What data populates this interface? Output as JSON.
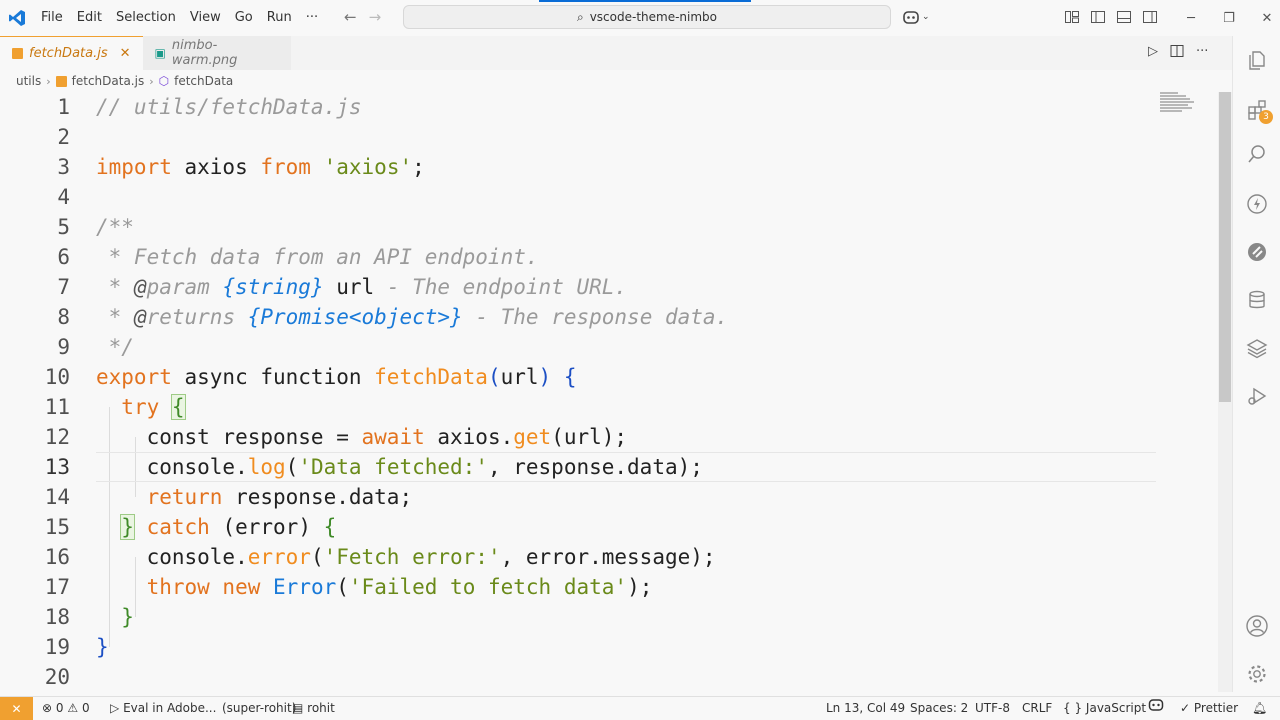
{
  "menu": [
    "File",
    "Edit",
    "Selection",
    "View",
    "Go",
    "Run",
    "···"
  ],
  "search": {
    "text": "vscode-theme-nimbo"
  },
  "tabs": [
    {
      "label": "fetchData.js",
      "icon": "js-file-icon"
    },
    {
      "label": "nimbo-warm.png",
      "icon": "image-file-icon"
    }
  ],
  "breadcrumb": {
    "folder": "utils",
    "file": "fetchData.js",
    "symbol": "fetchData"
  },
  "line_numbers": [
    "1",
    "2",
    "3",
    "4",
    "5",
    "6",
    "7",
    "8",
    "9",
    "10",
    "11",
    "12",
    "13",
    "14",
    "15",
    "16",
    "17",
    "18",
    "19",
    "20"
  ],
  "current_line": 13,
  "activity": {
    "badge": "3"
  },
  "status": {
    "errors": "0",
    "warnings": "0",
    "eval": "Eval in Adobe...",
    "branch": "(super-rohit)",
    "user": "rohit",
    "position": "Ln 13, Col 49",
    "spaces": "Spaces: 2",
    "encoding": "UTF-8",
    "eol": "CRLF",
    "language": "JavaScript",
    "formatter": "Prettier"
  },
  "colors": {
    "accent": "#f0a030",
    "keyword": "#e2731f",
    "string": "#6a8a1a",
    "function": "#f08c1f",
    "type": "#1a7ad8",
    "comment": "#9a9a9a"
  }
}
